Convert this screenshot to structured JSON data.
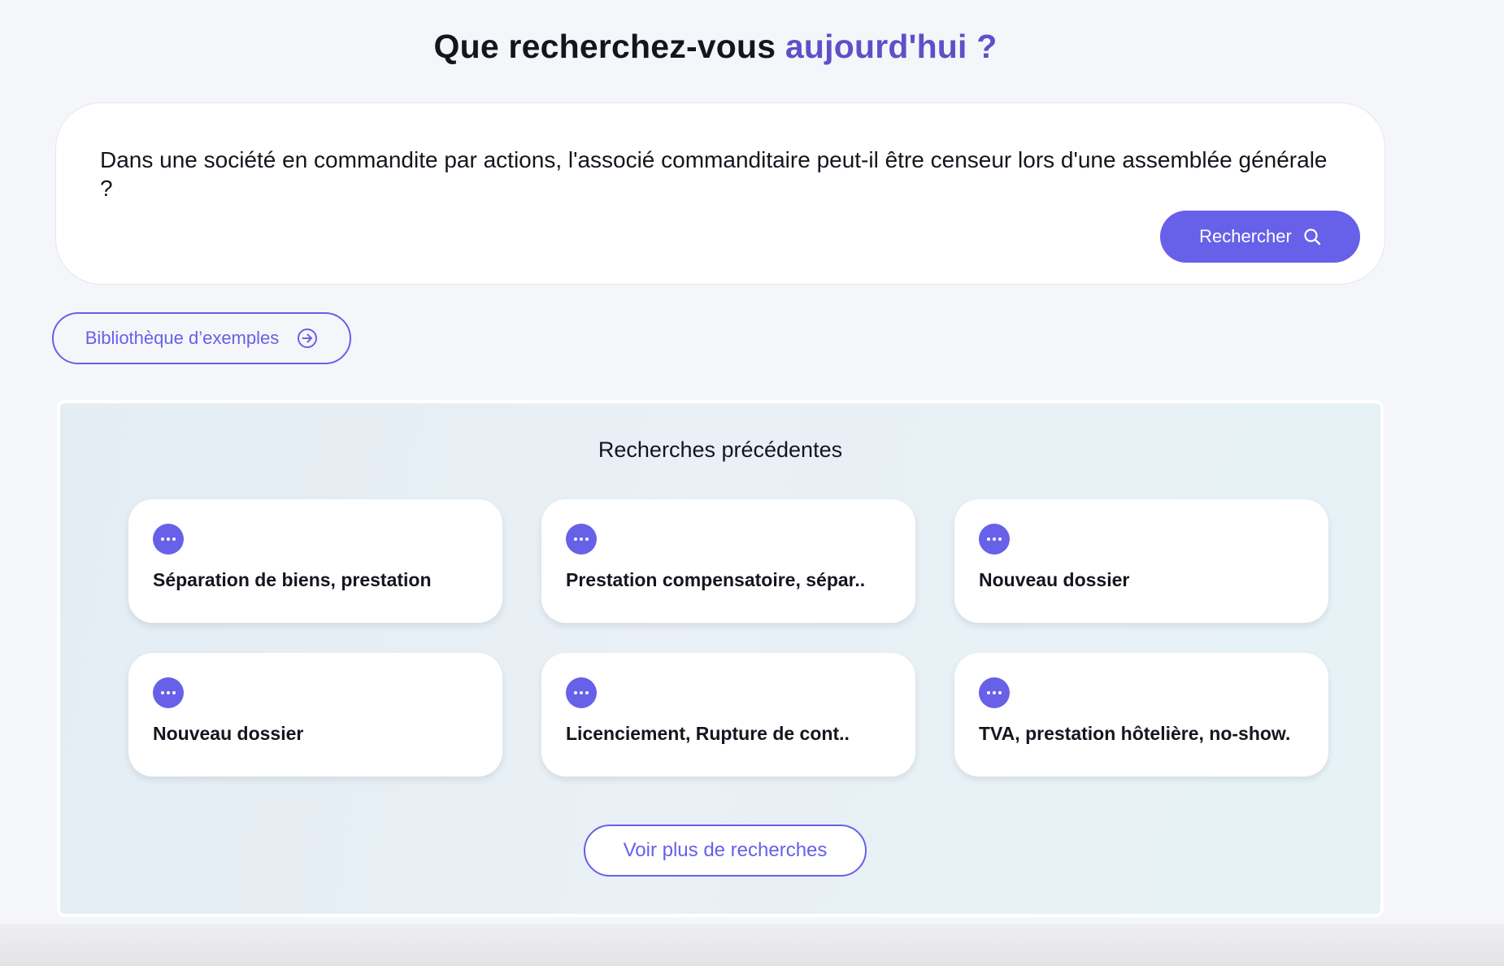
{
  "header": {
    "title_part1": "Que recherchez-vous",
    "title_part2": "aujourd'hui ?",
    "colors": {
      "dark": "#15151f",
      "accent": "#5e50c8"
    }
  },
  "search": {
    "query": "Dans une société en commandite par actions, l'associé commanditaire peut-il être censeur lors d'une assemblée générale ?",
    "button_label": "Rechercher",
    "button_icon": "search-icon"
  },
  "library": {
    "label": "Bibliothèque d’exemples",
    "icon": "arrow-right-circle-icon"
  },
  "history": {
    "title": "Recherches précédentes",
    "items": [
      {
        "label": "Séparation de biens, prestation",
        "icon": "more-dots-icon"
      },
      {
        "label": "Prestation compensatoire, sépar..",
        "icon": "more-dots-icon"
      },
      {
        "label": "Nouveau dossier",
        "icon": "more-dots-icon"
      },
      {
        "label": "Nouveau dossier",
        "icon": "more-dots-icon"
      },
      {
        "label": "Licenciement, Rupture de cont..",
        "icon": "more-dots-icon"
      },
      {
        "label": "TVA, prestation hôtelière, no-show.",
        "icon": "more-dots-icon"
      }
    ],
    "more_label": "Voir plus de recherches"
  },
  "theme": {
    "brand": "#6760e8",
    "background": "#f5f6fa"
  }
}
